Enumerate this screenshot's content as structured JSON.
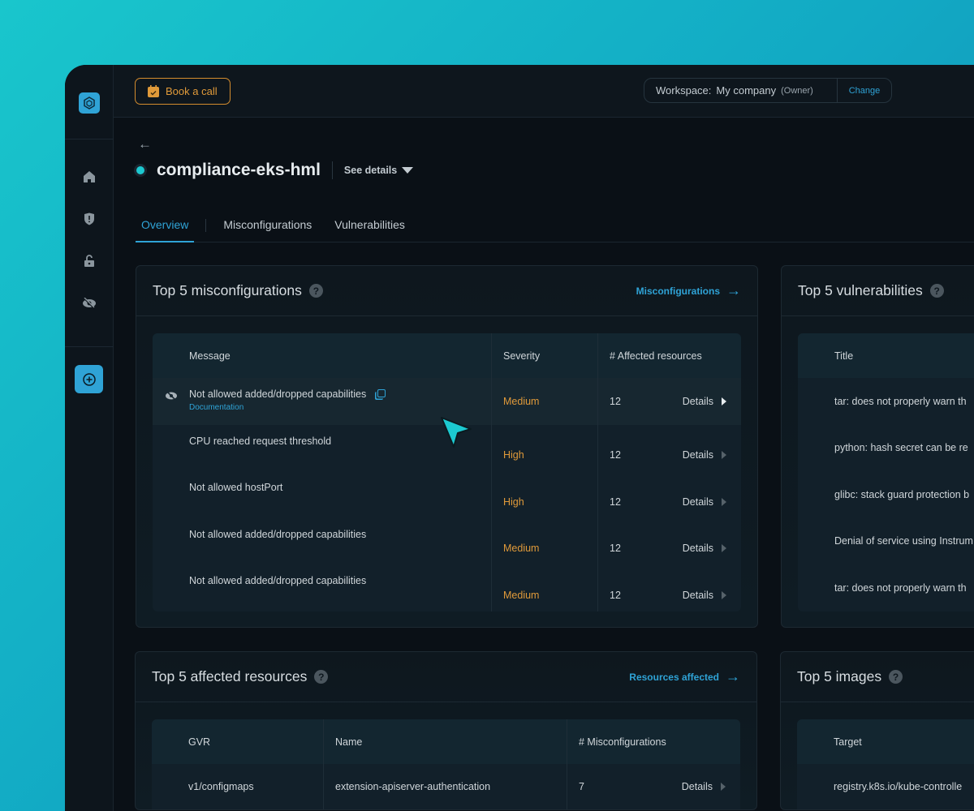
{
  "header": {
    "book_call": "Book a call",
    "workspace_label": "Workspace:",
    "workspace_name": "My company",
    "workspace_role": "(Owner)",
    "change": "Change"
  },
  "page": {
    "title": "compliance-eks-hml",
    "see_details": "See details"
  },
  "tabs": [
    "Overview",
    "Misconfigurations",
    "Vulnerabilities"
  ],
  "misconfig": {
    "title": "Top 5 misconfigurations",
    "link": "Misconfigurations",
    "columns": [
      "Message",
      "Severity",
      "# Affected resources"
    ],
    "rows": [
      {
        "message": "Not allowed added/dropped capabilities",
        "doc": "Documentation",
        "severity": "Medium",
        "affected": "12",
        "details": "Details"
      },
      {
        "message": "CPU reached request threshold",
        "severity": "High",
        "affected": "12",
        "details": "Details"
      },
      {
        "message": "Not allowed hostPort",
        "severity": "High",
        "affected": "12",
        "details": "Details"
      },
      {
        "message": "Not allowed added/dropped capabilities",
        "severity": "Medium",
        "affected": "12",
        "details": "Details"
      },
      {
        "message": "Not allowed added/dropped capabilities",
        "severity": "Medium",
        "affected": "12",
        "details": "Details"
      }
    ]
  },
  "vulns": {
    "title": "Top 5 vulnerabilities",
    "columns": [
      "Title"
    ],
    "rows": [
      "tar: does not properly warn th",
      "python: hash secret can be re",
      "glibc: stack guard protection b",
      "Denial of service using Instrum",
      "tar: does not properly warn th"
    ]
  },
  "resources": {
    "title": "Top 5 affected resources",
    "link": "Resources affected",
    "columns": [
      "GVR",
      "Name",
      "# Misconfigurations"
    ],
    "rows": [
      {
        "gvr": "v1/configmaps",
        "name": "extension-apiserver-authentication",
        "count": "7",
        "details": "Details"
      }
    ]
  },
  "images": {
    "title": "Top 5 images",
    "columns": [
      "Target"
    ],
    "rows": [
      "registry.k8s.io/kube-controlle"
    ]
  },
  "colors": {
    "accent": "#2fa3d6",
    "warning": "#e09a3a",
    "cursor": "#1cc9d0"
  }
}
